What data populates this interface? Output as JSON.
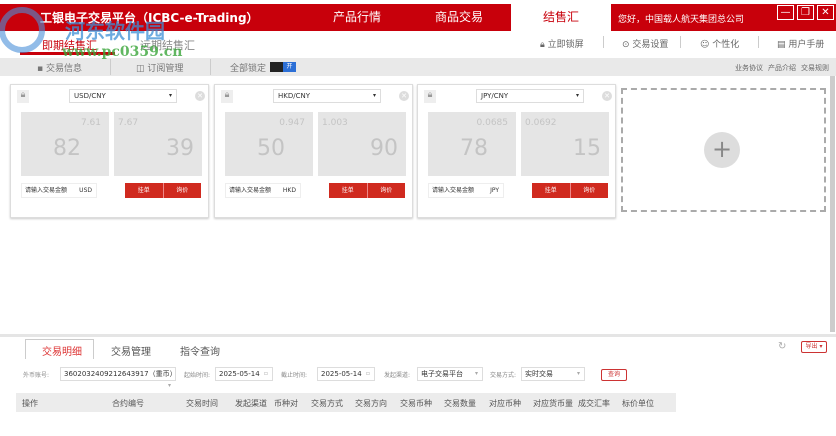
{
  "header": {
    "title": "工银电子交易平台（ICBC-e-Trading）",
    "nav": [
      "产品行情",
      "商品交易",
      "结售汇"
    ],
    "greeting": "您好，中国载人航天集团总公司",
    "window_controls": [
      "—",
      "❐",
      "✕"
    ]
  },
  "subnav": {
    "tabs": [
      "即期结售汇",
      "远期结售汇"
    ],
    "tools": [
      "立即锁屏",
      "交易设置",
      "个性化",
      "用户手册"
    ]
  },
  "toolbar": {
    "items": [
      "交易信息",
      "订阅管理"
    ],
    "lock_all_label": "全部锁定",
    "toggle_label": "开",
    "links": [
      "业务协议",
      "产品介绍",
      "交易规则"
    ]
  },
  "cards": [
    {
      "pair": "USD/CNY",
      "bid_small": "7.61",
      "bid_big": "82",
      "ask_small": "7.67",
      "ask_big": "39",
      "amount_placeholder": "请输入交易金额",
      "currency": "USD",
      "order_label": "挂单",
      "quote_label": "询价"
    },
    {
      "pair": "HKD/CNY",
      "bid_small": "0.947",
      "bid_big": "50",
      "ask_small": "1.003",
      "ask_big": "90",
      "amount_placeholder": "请输入交易金额",
      "currency": "HKD",
      "order_label": "挂单",
      "quote_label": "询价"
    },
    {
      "pair": "JPY/CNY",
      "bid_small": "0.0685",
      "bid_big": "78",
      "ask_small": "0.0692",
      "ask_big": "15",
      "amount_placeholder": "请输入交易金额",
      "currency": "JPY",
      "order_label": "挂单",
      "quote_label": "询价"
    }
  ],
  "add_card": {
    "icon": "+"
  },
  "bottom": {
    "tabs": [
      "交易明细",
      "交易管理",
      "指令查询"
    ],
    "export_label": "导出 ▾",
    "filters": {
      "account_label": "外币账号:",
      "account_value": "3602032409212643917（重币）",
      "start_label": "起始时间:",
      "start_value": "2025-05-14",
      "end_label": "截止时间:",
      "end_value": "2025-05-14",
      "channel_label": "发起渠道:",
      "channel_value": "电子交易平台",
      "mode_label": "交易方式:",
      "mode_value": "实时交易",
      "query_label": "查询"
    },
    "columns": [
      "操作",
      "合约编号",
      "交易时间",
      "发起渠道",
      "币种对",
      "交易方式",
      "交易方向",
      "交易币种",
      "交易数量",
      "对应币种",
      "对应货币量",
      "成交汇率",
      "标价单位"
    ]
  },
  "watermark": {
    "text": "河东软件园",
    "url": "www.pc0359.cn"
  }
}
